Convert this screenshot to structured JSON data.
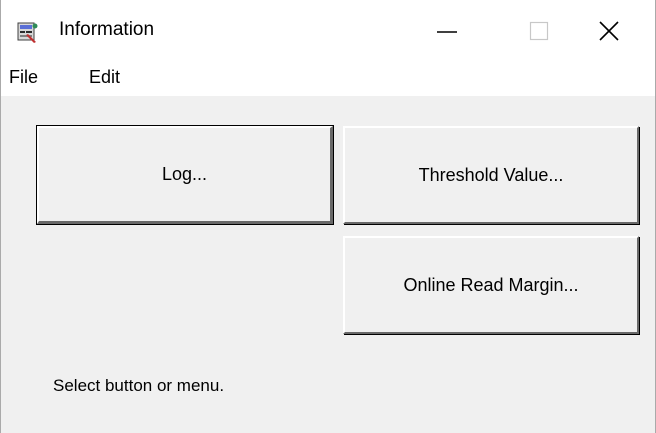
{
  "window": {
    "title": "Information",
    "minimize_label": "—",
    "close_label": "✕"
  },
  "menubar": {
    "items": [
      {
        "label": "File"
      },
      {
        "label": "Edit"
      }
    ]
  },
  "buttons": {
    "log_label": "Log...",
    "threshold_label": "Threshold Value...",
    "online_label": "Online Read Margin..."
  },
  "status": {
    "text": "Select button or menu."
  },
  "colors": {
    "face": "#f0f0f0",
    "titlebar": "#ffffff",
    "text": "#000000"
  },
  "icons": {
    "app": "app-icon",
    "minimize": "minimize-icon",
    "maximize": "maximize-icon",
    "close": "close-icon"
  }
}
